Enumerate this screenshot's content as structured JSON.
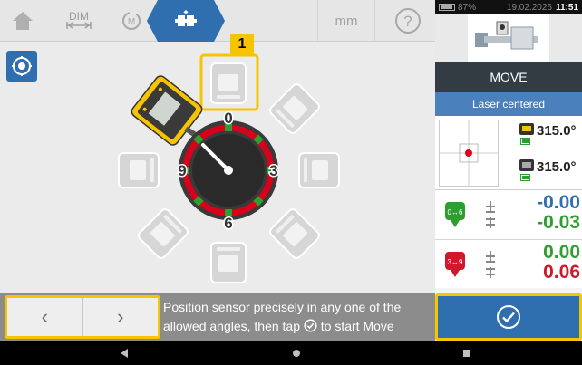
{
  "toolbar": {
    "dim_label": "DIM",
    "unit_label": "mm",
    "help_label": "?"
  },
  "diagram": {
    "callout_number": "1",
    "clock_labels": {
      "top": "0",
      "right": "3",
      "bottom": "6",
      "left": "9"
    }
  },
  "bottom": {
    "prev_label": "‹",
    "next_label": "›",
    "instruction_line1": "Position sensor precisely in any one of the",
    "instruction_line2_pre": "allowed angles, then tap",
    "instruction_line2_post": "to start Move"
  },
  "status": {
    "battery": "87%",
    "date": "19.02.2026",
    "time": "11:51"
  },
  "panel": {
    "title": "MOVE",
    "laser_status": "Laser centered",
    "sensor_reading": "315.0°",
    "sender_reading": "315.0°",
    "vertical": {
      "label": "0↔6",
      "offset": "-0.00",
      "angularity": "-0.03"
    },
    "horizontal": {
      "label": "3↔9",
      "offset": "0.00",
      "angularity": "0.06"
    }
  },
  "colors": {
    "accent": "#2f6fb0",
    "highlight": "#f6c400",
    "positive_green": "#2e9e2e",
    "negative_red": "#d0182b",
    "vertical_blue": "#2f6fb0"
  }
}
